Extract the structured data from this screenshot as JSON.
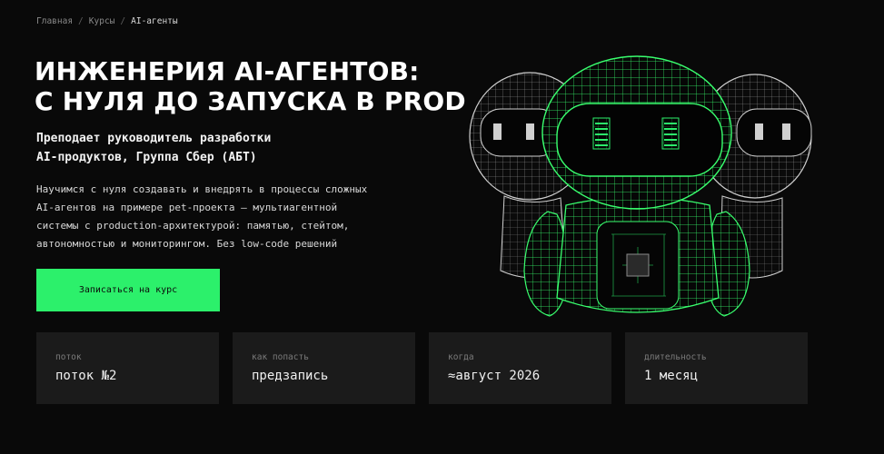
{
  "breadcrumb": {
    "items": [
      "Главная",
      "Курсы"
    ],
    "separator": "/",
    "current": "AI-агенты"
  },
  "hero": {
    "title_lines": [
      "ИНЖЕНЕРИЯ AI-АГЕНТОВ:",
      "С НУЛЯ ДО ЗАПУСКА В PROD"
    ],
    "teacher_lines": [
      "Преподает руководитель разработки",
      "AI-продуктов, Группа Сбер (АБТ)"
    ],
    "description_lines": [
      "Научимся с нуля создавать и внедрять в процессы сложных",
      "AI-агентов на примере pet-проекта — мультиагентной",
      "системы с production-архитектурой: памятью, стейтом,",
      "автономностью и мониторингом. Без low-code решений"
    ],
    "cta_label": "Записаться на курс"
  },
  "info_cards": [
    {
      "label": "поток",
      "value": "поток №2"
    },
    {
      "label": "как попасть",
      "value": "предзапись"
    },
    {
      "label": "когда",
      "value": "≈август 2026"
    },
    {
      "label": "длительность",
      "value": "1 месяц"
    }
  ],
  "theme": {
    "background": "#090909",
    "accent": "#2cf06b",
    "card_bg": "#1b1b1b"
  },
  "illustration": {
    "icon": "robot-wireframe-icon"
  }
}
